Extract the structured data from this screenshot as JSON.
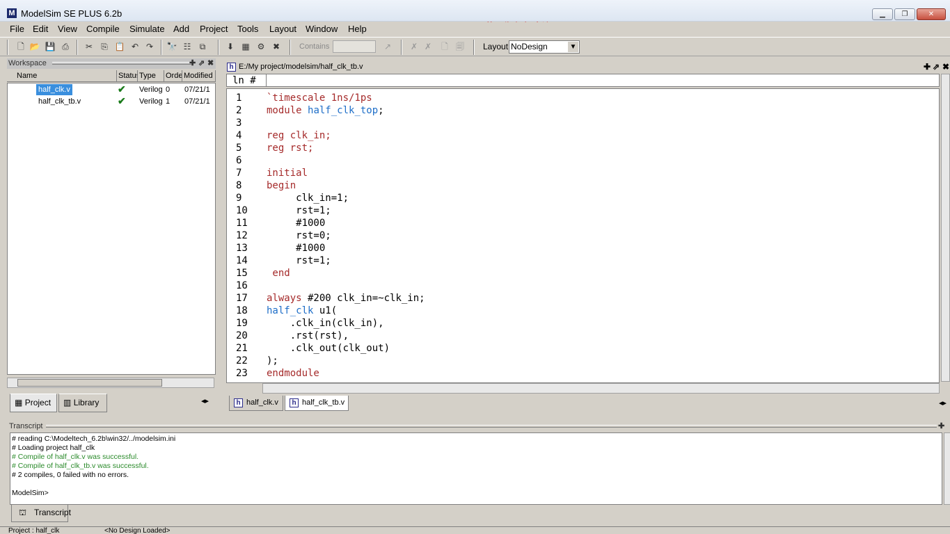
{
  "app": {
    "title": "ModelSim SE PLUS 6.2b",
    "logo": "M",
    "watermark": "屏幕录像专家 未注册"
  },
  "menu": [
    "File",
    "Edit",
    "View",
    "Compile",
    "Simulate",
    "Add",
    "Project",
    "Tools",
    "Layout",
    "Window",
    "Help"
  ],
  "toolbar": {
    "contains_label": "Contains",
    "layout_label": "Layout",
    "layout_value": "NoDesign"
  },
  "workspace": {
    "title": "Workspace",
    "columns": [
      "Name",
      "Status",
      "Type",
      "Order",
      "Modified"
    ],
    "files": [
      {
        "name": "half_clk.v",
        "type": "Verilog",
        "order": "0",
        "modified": "07/21/1",
        "selected": true
      },
      {
        "name": "half_clk_tb.v",
        "type": "Verilog",
        "order": "1",
        "modified": "07/21/1",
        "selected": false
      }
    ],
    "tabs": [
      "Project",
      "Library"
    ]
  },
  "editor": {
    "path": "E:/My project/modelsim/half_clk_tb.v",
    "gutter": "ln  #",
    "lines": [
      {
        "n": "1",
        "code": "`timescale 1ns/1ps",
        "style": "kw"
      },
      {
        "n": "2",
        "code": "module half_clk_top;",
        "style": "mixed-module"
      },
      {
        "n": "3",
        "code": "",
        "style": ""
      },
      {
        "n": "4",
        "code": "reg clk_in;",
        "style": "kw"
      },
      {
        "n": "5",
        "code": "reg rst;",
        "style": "kw"
      },
      {
        "n": "6",
        "code": "",
        "style": ""
      },
      {
        "n": "7",
        "code": "initial",
        "style": "kw"
      },
      {
        "n": "8",
        "code": "begin",
        "style": "kw"
      },
      {
        "n": "9",
        "code": "     clk_in=1;",
        "style": ""
      },
      {
        "n": "10",
        "code": "     rst=1;",
        "style": ""
      },
      {
        "n": "11",
        "code": "     #1000",
        "style": ""
      },
      {
        "n": "12",
        "code": "     rst=0;",
        "style": ""
      },
      {
        "n": "13",
        "code": "     #1000",
        "style": ""
      },
      {
        "n": "14",
        "code": "     rst=1;",
        "style": ""
      },
      {
        "n": "15",
        "code": " end",
        "style": "kw"
      },
      {
        "n": "16",
        "code": "",
        "style": ""
      },
      {
        "n": "17",
        "code": "always #200 clk_in=~clk_in;",
        "style": "mixed-always"
      },
      {
        "n": "18",
        "code": "half_clk u1(",
        "style": "mixed-inst"
      },
      {
        "n": "19",
        "code": "    .clk_in(clk_in),",
        "style": ""
      },
      {
        "n": "20",
        "code": "    .rst(rst),",
        "style": ""
      },
      {
        "n": "21",
        "code": "    .clk_out(clk_out)",
        "style": ""
      },
      {
        "n": "22",
        "code": ");",
        "style": ""
      },
      {
        "n": "23",
        "code": "endmodule",
        "style": "kw"
      }
    ],
    "tabs": [
      "half_clk.v",
      "half_clk_tb.v"
    ]
  },
  "transcript": {
    "title": "Transcript",
    "lines": [
      {
        "text": "# reading C:\\Modeltech_6.2b\\win32/../modelsim.ini",
        "ok": false
      },
      {
        "text": "# Loading project half_clk",
        "ok": false
      },
      {
        "text": "# Compile of half_clk.v was successful.",
        "ok": true
      },
      {
        "text": "# Compile of half_clk_tb.v was successful.",
        "ok": true
      },
      {
        "text": "# 2 compiles, 0 failed with no errors.",
        "ok": false
      }
    ],
    "prompt": "ModelSim>",
    "tab": "Transcript"
  },
  "status": {
    "left": "Project : half_clk",
    "mid": "<No Design Loaded>"
  },
  "colors": {
    "keyword": "#a52a2a",
    "identifier": "#1e6ec8",
    "success": "#2a8a2a",
    "selection": "#3a8fde"
  }
}
